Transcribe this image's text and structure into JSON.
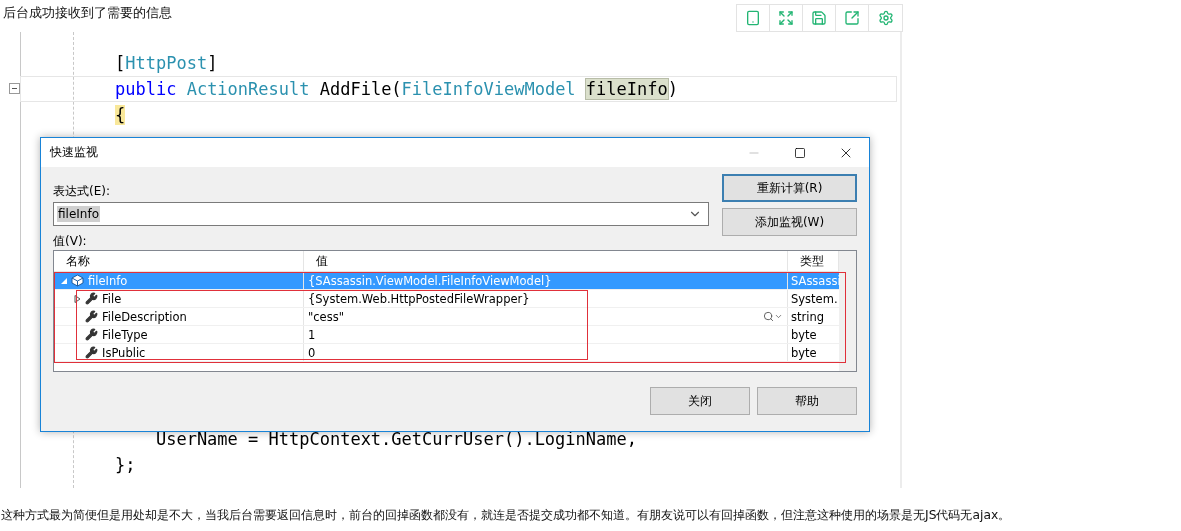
{
  "heading": "后台成功接收到了需要的信息",
  "code_top": [
    {
      "tokens": [
        {
          "kind": "plain",
          "text": "["
        },
        {
          "kind": "type",
          "text": "HttpPost"
        },
        {
          "kind": "plain",
          "text": "]"
        }
      ],
      "fold": false,
      "current": false
    },
    {
      "tokens": [
        {
          "kind": "keyword",
          "text": "public "
        },
        {
          "kind": "type",
          "text": "ActionResult "
        },
        {
          "kind": "plain",
          "text": "AddFile("
        },
        {
          "kind": "type",
          "text": "FileInfoViewModel "
        },
        {
          "kind": "highlight",
          "text": "fileInfo"
        },
        {
          "kind": "plain",
          "text": ")"
        }
      ],
      "fold": true,
      "current": true
    },
    {
      "tokens": [
        {
          "kind": "brace",
          "text": "{"
        }
      ],
      "fold": false,
      "current": false
    }
  ],
  "code_bottom": [
    {
      "tokens": [
        {
          "kind": "plain",
          "text": "    UserName = HttpContext.GetCurrUser().LoginName,"
        }
      ],
      "fold": false,
      "current": false
    },
    {
      "tokens": [
        {
          "kind": "plain",
          "text": "};"
        }
      ],
      "fold": false,
      "current": false
    }
  ],
  "dialog": {
    "title": "快速监视",
    "expression_label": "表达式(E):",
    "expression": "fileInfo",
    "value_label": "值(V):",
    "side_buttons": [
      {
        "label": "重新计算(R)",
        "default": true
      },
      {
        "label": "添加监视(W)",
        "default": false
      }
    ],
    "columns": [
      "名称",
      "值",
      "类型"
    ],
    "rows": [
      {
        "name": "fileInfo",
        "value": "{SAssassin.ViewModel.FileInfoViewModel}",
        "type": "SAssassi",
        "selected": true,
        "expanded": true,
        "kind": "object",
        "children": [
          {
            "name": "File",
            "value": "{System.Web.HttpPostedFileWrapper}",
            "type": "System.",
            "selected": false,
            "expanded": false,
            "kind": "expandable"
          },
          {
            "name": "FileDescription",
            "value": "\"cess\"",
            "type": "string",
            "selected": false,
            "kind": "string"
          },
          {
            "name": "FileType",
            "value": "1",
            "type": "byte",
            "selected": false,
            "kind": "property"
          },
          {
            "name": "IsPublic",
            "value": "0",
            "type": "byte",
            "selected": false,
            "kind": "property"
          }
        ]
      }
    ],
    "footer_buttons": [
      "关闭",
      "帮助"
    ]
  },
  "paragraph": "这种方式最为简便但是用处却是不大，当我后台需要返回信息时，前台的回掉函数都没有，就连是否提交成功都不知道。有朋友说可以有回掉函数，但注意这种使用的场景是无JS代码无ajax。"
}
